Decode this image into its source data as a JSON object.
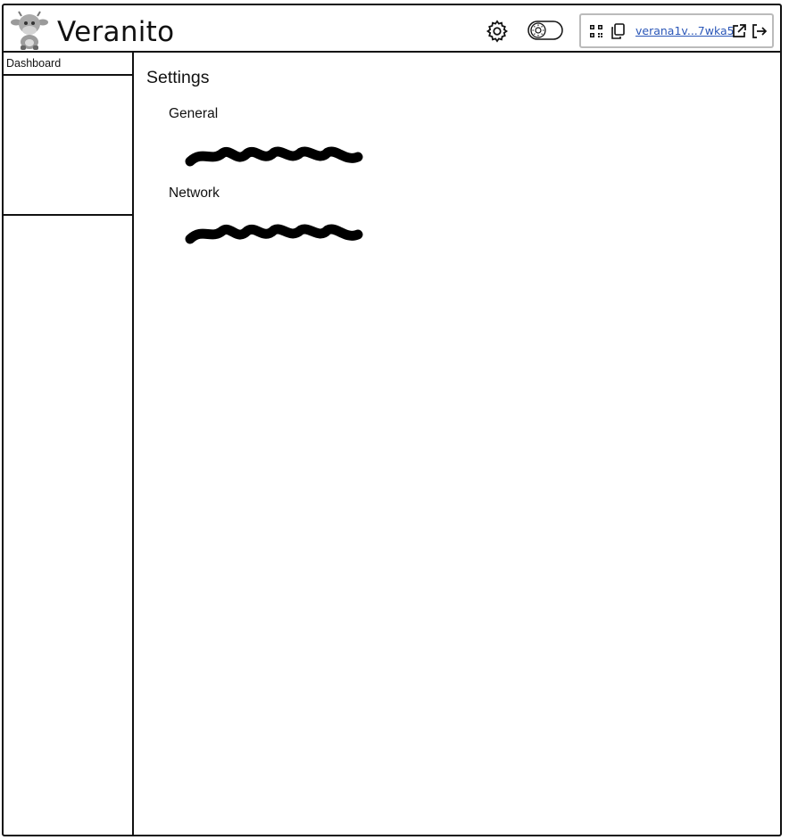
{
  "header": {
    "app_title": "Veranito",
    "logo_icon": "cow-mascot-icon",
    "settings_icon": "gear-icon",
    "theme_toggle_icon": "theme-toggle-icon",
    "wallet": {
      "qr_icon": "qr-code-icon",
      "copy_icon": "copy-icon",
      "address": "verana1v...7wka5",
      "address_color": "#2b57b8",
      "external_icon": "external-link-icon",
      "logout_icon": "logout-icon"
    }
  },
  "sidebar": {
    "items": [
      {
        "label": "Dashboard"
      }
    ]
  },
  "main": {
    "title": "Settings",
    "sections": [
      {
        "heading": "General"
      },
      {
        "heading": "Network"
      }
    ]
  }
}
